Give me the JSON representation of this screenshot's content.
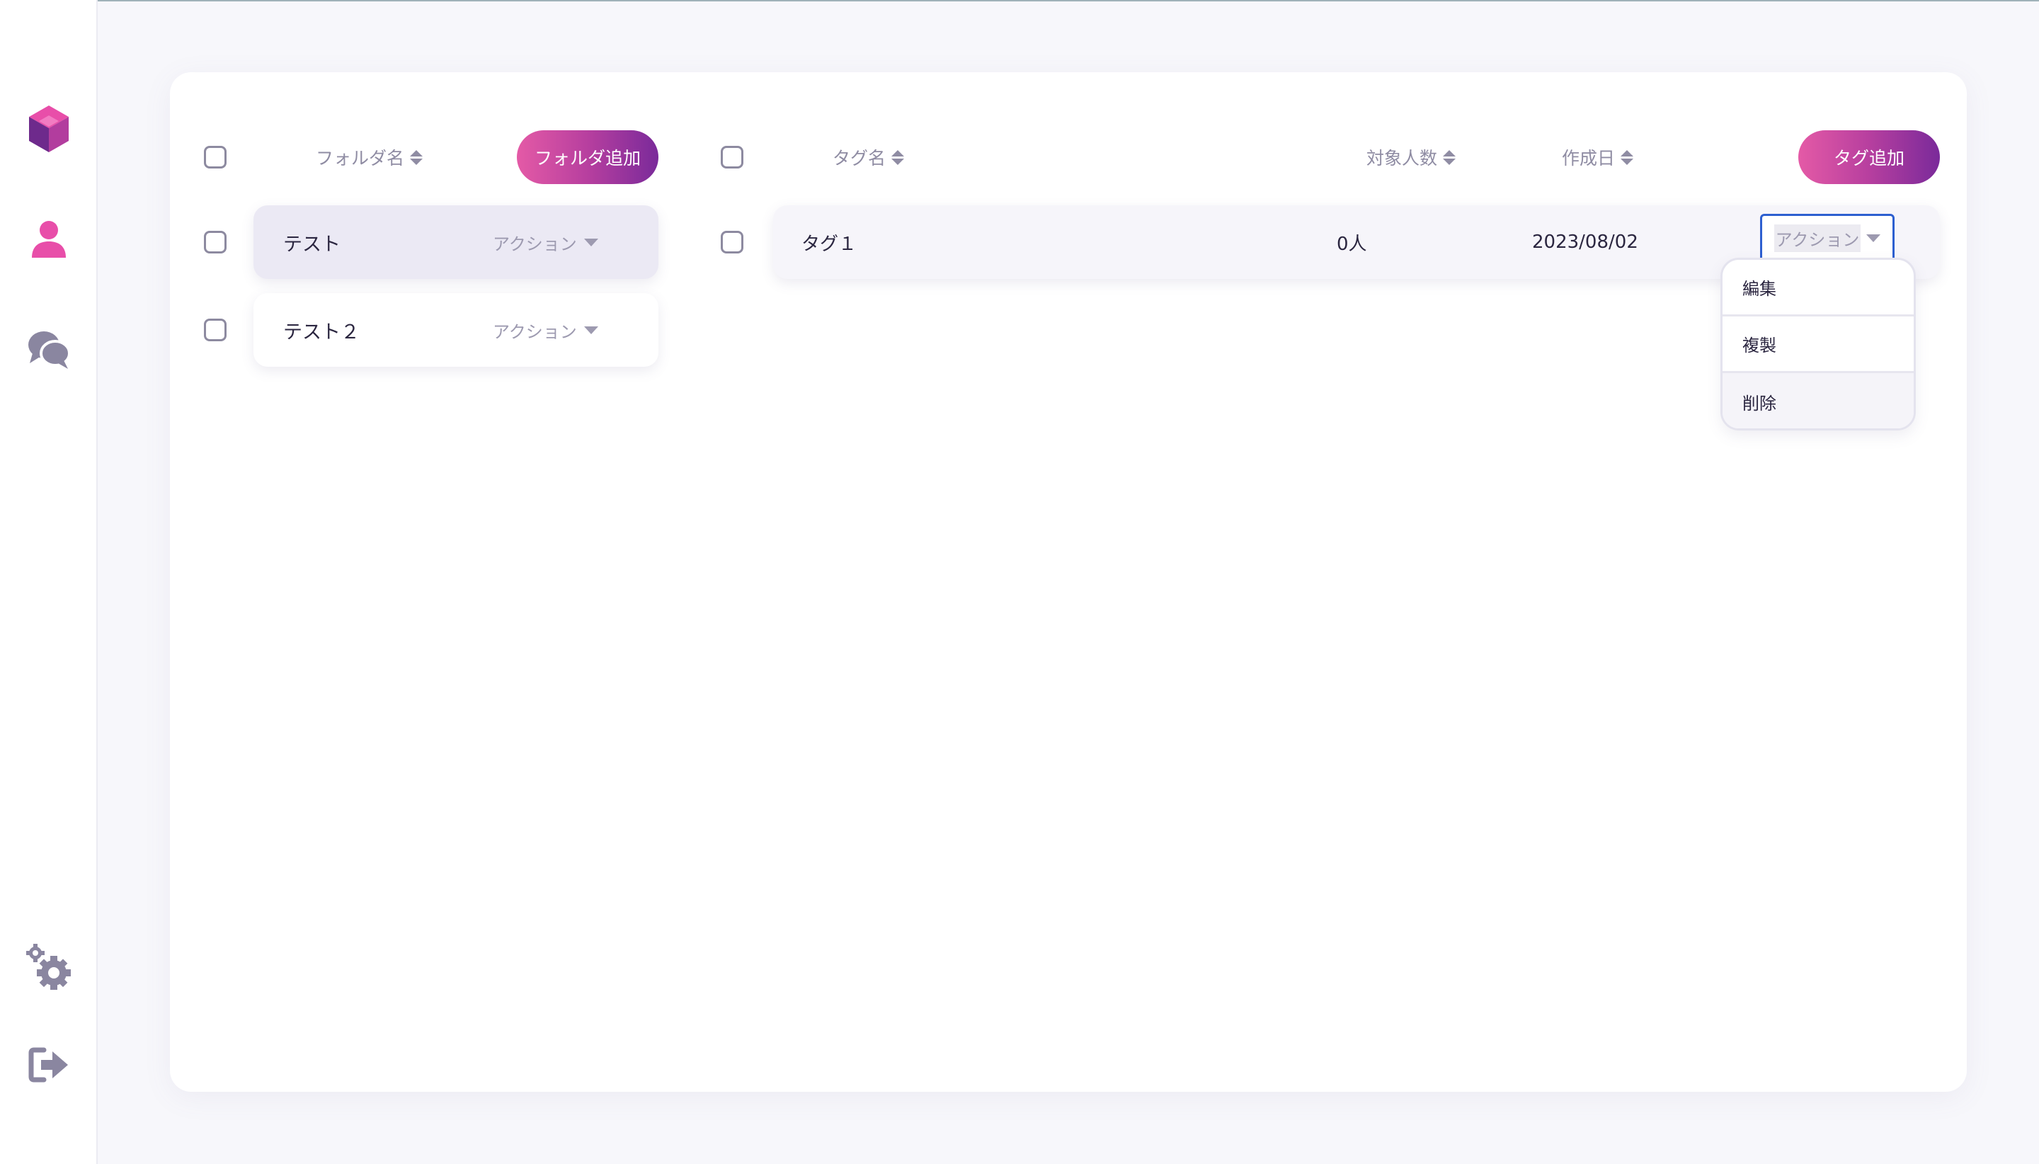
{
  "sidebar": {
    "items": [
      {
        "name": "logo",
        "icon": "cube-logo-icon"
      },
      {
        "name": "users",
        "icon": "user-icon",
        "active": true
      },
      {
        "name": "chat",
        "icon": "chat-icon"
      },
      {
        "name": "settings",
        "icon": "gear-icon"
      },
      {
        "name": "logout",
        "icon": "logout-icon"
      }
    ]
  },
  "folders": {
    "header_label": "フォルダ名",
    "add_button": "フォルダ追加",
    "rows": [
      {
        "name": "テスト",
        "action": "アクション",
        "selected": true
      },
      {
        "name": "テスト２",
        "action": "アクション",
        "selected": false
      }
    ]
  },
  "tags": {
    "headers": {
      "name": "タグ名",
      "count": "対象人数",
      "date": "作成日"
    },
    "add_button": "タグ追加",
    "rows": [
      {
        "name": "タグ１",
        "count": "0人",
        "date": "2023/08/02",
        "action": "アクション"
      }
    ]
  },
  "action_menu": {
    "items": [
      "編集",
      "複製",
      "削除"
    ]
  },
  "colors": {
    "accent_pink": "#e45aa6",
    "accent_purple": "#7a2a9a",
    "focus_blue": "#2d5fd0"
  }
}
